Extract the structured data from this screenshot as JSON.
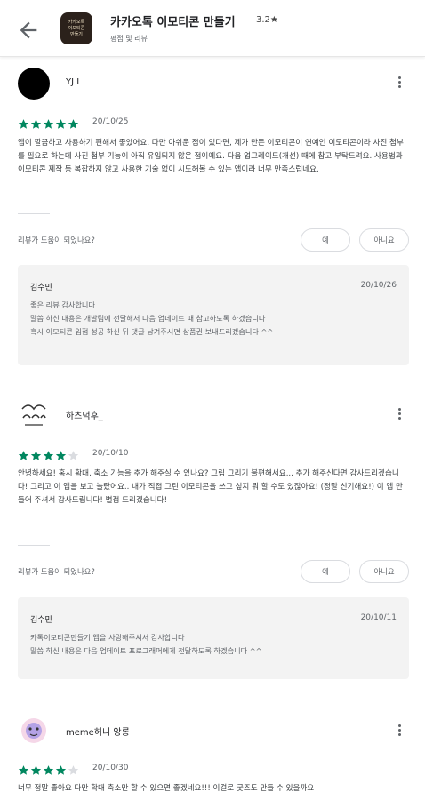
{
  "header": {
    "title": "카카오톡 이모티콘 만들기",
    "rating": "3.2★",
    "subtitle": "평점 및 리뷰",
    "icon_text": [
      "카카오톡",
      "이모티콘",
      "만들기"
    ],
    "back_icon": "arrow-left-icon"
  },
  "reviews": [
    {
      "author": "YJ L",
      "stars": 5,
      "date": "20/10/25",
      "text": "앱이 깔끔하고 사용하기 편해서 좋았어요. 다만 아쉬운 점이 있다면, 제가 만든 이모티콘이 연예인 이모티콘이라 사진 첨부를 필요로 하는데 사진 첨부 기능이 아직 유입되지 않은 점이에요. 다음 업그레이드(개선) 때에 참고 부탁드려요. 사용법과 이모티콘 제작 등 복잡하지 않고 사용한 기술 없이 시도해볼 수 있는 앱이라 너무 만족스럽네요.",
      "helpful_q": "리뷰가 도움이 되었나요?",
      "yes": "예",
      "no": "아니요",
      "reply": {
        "name": "김수민",
        "date": "20/10/26",
        "text": "좋은 리뷰 감사합니다\n말씀 하신 내용은 개발팀에 전달해서 다음 업데이트 때 참고하도록 하겠습니다\n혹시 이모티콘 입점 성공 하신 뒤 댓글 남겨주시면 상품권 보내드리겠습니다 ^^"
      }
    },
    {
      "author": "하츠덕후_",
      "stars": 4,
      "date": "20/10/10",
      "text": "안녕하세요! 혹시 확대, 축소 기능을 추가 해주실 수 있나요? 그림 그리기 불편해서요... 추가 해주신다면 감사드리겠습니다! 그리고 이 앱을 보고 놀랐어요.. 내가 직접 그린 이모티콘을 쓰고 싶지 뭐 할 수도 있잖아요! (정말 신기해요!) 이 앱 만들어 주셔서 감사드립니다! 별점 드리겠습니다!",
      "helpful_q": "리뷰가 도움이 되었나요?",
      "yes": "예",
      "no": "아니요",
      "reply": {
        "name": "김수민",
        "date": "20/10/11",
        "text": "카톡이모티콘만들기 앱을 사랑해주셔서 감사합니다\n말씀 하신 내용은 다음 업데이트 프로그래머에게 전달하도록 하겠습니다 ^^"
      }
    },
    {
      "author": "meme허니 앙롱",
      "stars": 4,
      "date": "20/10/30",
      "text": "너무 정말 좋아요 다만 확대 축소만 할 수 있으면 좋겠네요!!! 이걸로 굿즈도 만들 수 있을까요"
    }
  ],
  "colors": {
    "star": "#01875f",
    "star_empty": "#dadce0",
    "reply_bg": "#f3f3f3"
  }
}
